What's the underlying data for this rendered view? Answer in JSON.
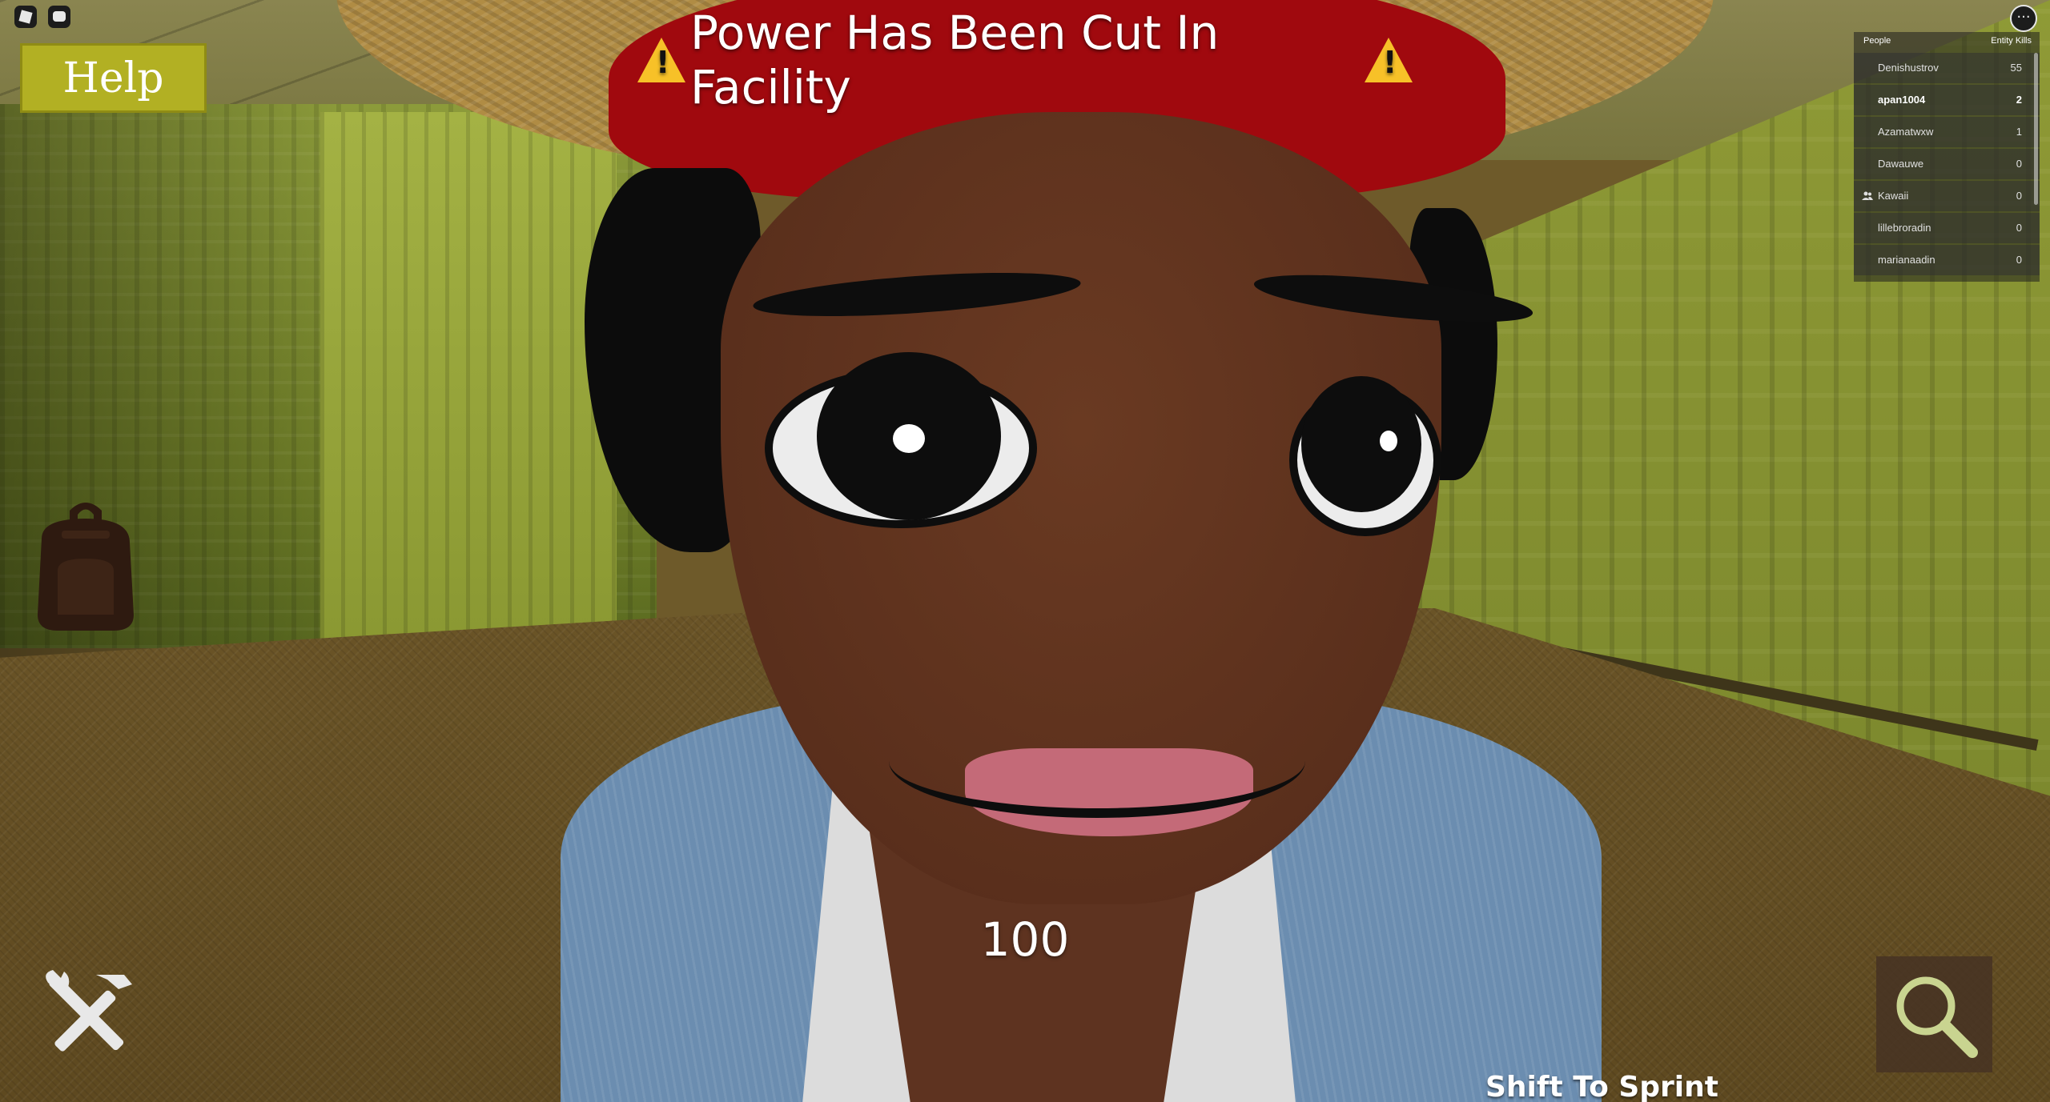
{
  "hud": {
    "help_label": "Help",
    "notice_text": "Power Has Been Cut In Facility",
    "more_label": "···",
    "counter_value": "100",
    "sprint_hint": "Shift To Sprint"
  },
  "leaderboard": {
    "header_people": "People",
    "header_kills": "Entity Kills",
    "rows": [
      {
        "name": "Denishustrov",
        "score": "55"
      },
      {
        "name": "apan1004",
        "score": "2"
      },
      {
        "name": "Azamatwxw",
        "score": "1"
      },
      {
        "name": "Dawauwe",
        "score": "0"
      },
      {
        "name": "Kawaii",
        "score": "0"
      },
      {
        "name": "lillebroradin",
        "score": "0"
      },
      {
        "name": "marianaadin",
        "score": "0"
      }
    ]
  },
  "colors": {
    "help_button": "#b2b023",
    "warning_icon": "#f7c128",
    "wall": "#8c9b3a",
    "floor": "#6a5427"
  },
  "icons": {
    "top_left": [
      "roblox-menu-icon",
      "chat-icon"
    ],
    "top_right": "more-options-icon",
    "left": "backpack-icon",
    "bottom_left": "tools-icon",
    "bottom_right": "search-icon"
  }
}
